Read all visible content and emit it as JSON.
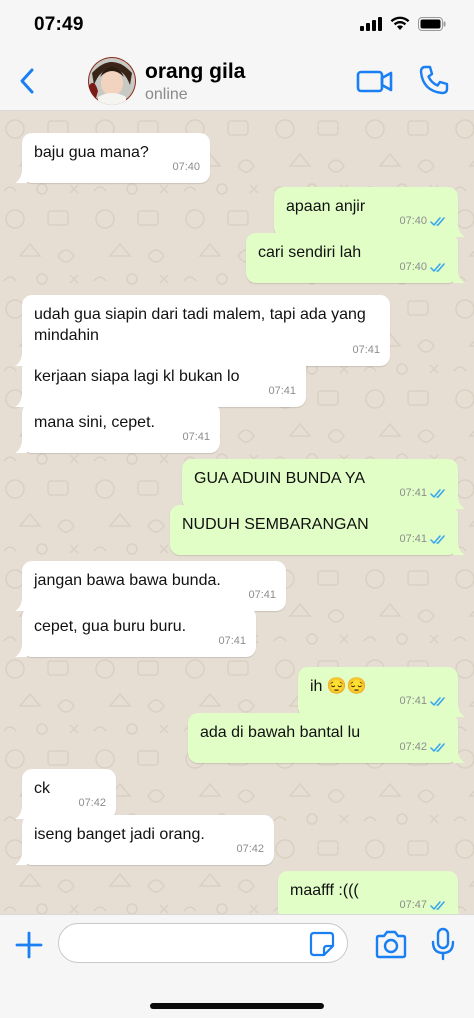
{
  "status_bar": {
    "time": "07:49"
  },
  "header": {
    "contact_name": "orang gila",
    "contact_status": "online",
    "accent_color": "#1a7ff2"
  },
  "messages": [
    {
      "direction": "in",
      "text": "baju gua mana?",
      "time": "07:40"
    },
    {
      "direction": "out",
      "text": "apaan anjir",
      "time": "07:40",
      "read": true
    },
    {
      "direction": "out",
      "text": "cari sendiri lah",
      "time": "07:40",
      "read": true
    },
    {
      "direction": "in",
      "text": "udah gua siapin dari tadi malem, tapi ada yang mindahin",
      "time": "07:41"
    },
    {
      "direction": "in",
      "text": "kerjaan siapa lagi kl bukan lo",
      "time": "07:41"
    },
    {
      "direction": "in",
      "text": "mana sini, cepet.",
      "time": "07:41"
    },
    {
      "direction": "out",
      "text": "GUA ADUIN BUNDA YA",
      "time": "07:41",
      "read": true
    },
    {
      "direction": "out",
      "text": "NUDUH SEMBARANGAN",
      "time": "07:41",
      "read": true
    },
    {
      "direction": "in",
      "text": "jangan bawa bawa bunda.",
      "time": "07:41"
    },
    {
      "direction": "in",
      "text": "cepet, gua buru buru.",
      "time": "07:41"
    },
    {
      "direction": "out",
      "text": "ih 😔😔",
      "time": "07:41",
      "read": true
    },
    {
      "direction": "out",
      "text": "ada di bawah bantal lu",
      "time": "07:42",
      "read": true
    },
    {
      "direction": "in",
      "text": "ck",
      "time": "07:42"
    },
    {
      "direction": "in",
      "text": "iseng banget jadi orang.",
      "time": "07:42"
    },
    {
      "direction": "out",
      "text": "maafff :(((",
      "time": "07:47",
      "read": true
    }
  ],
  "input": {
    "value": "",
    "placeholder": ""
  }
}
